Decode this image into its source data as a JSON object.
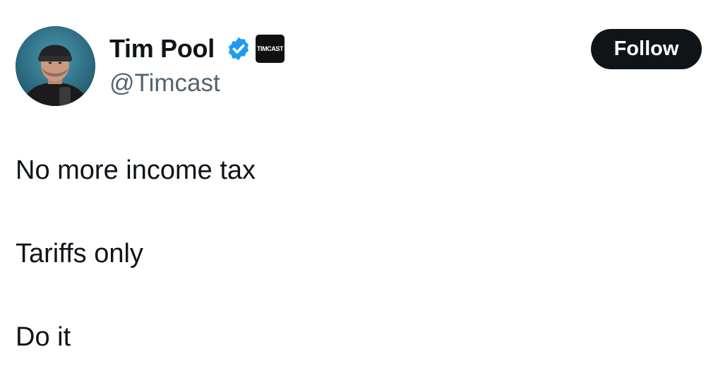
{
  "author": {
    "display_name": "Tim Pool",
    "handle": "@Timcast",
    "affiliate_label": "TIMCAST",
    "verified": true
  },
  "follow_button": {
    "label": "Follow"
  },
  "tweet": {
    "lines": [
      "No more income tax",
      "Tariffs only",
      "Do it"
    ]
  },
  "colors": {
    "text": "#0f1419",
    "handle": "#536471",
    "verified": "#1d9bf0",
    "follow_bg": "#0f1419",
    "follow_text": "#ffffff",
    "affiliate_bg": "#111111"
  },
  "icons": {
    "verified": "verified-checkmark-icon",
    "affiliate": "timcast-logo-badge"
  }
}
